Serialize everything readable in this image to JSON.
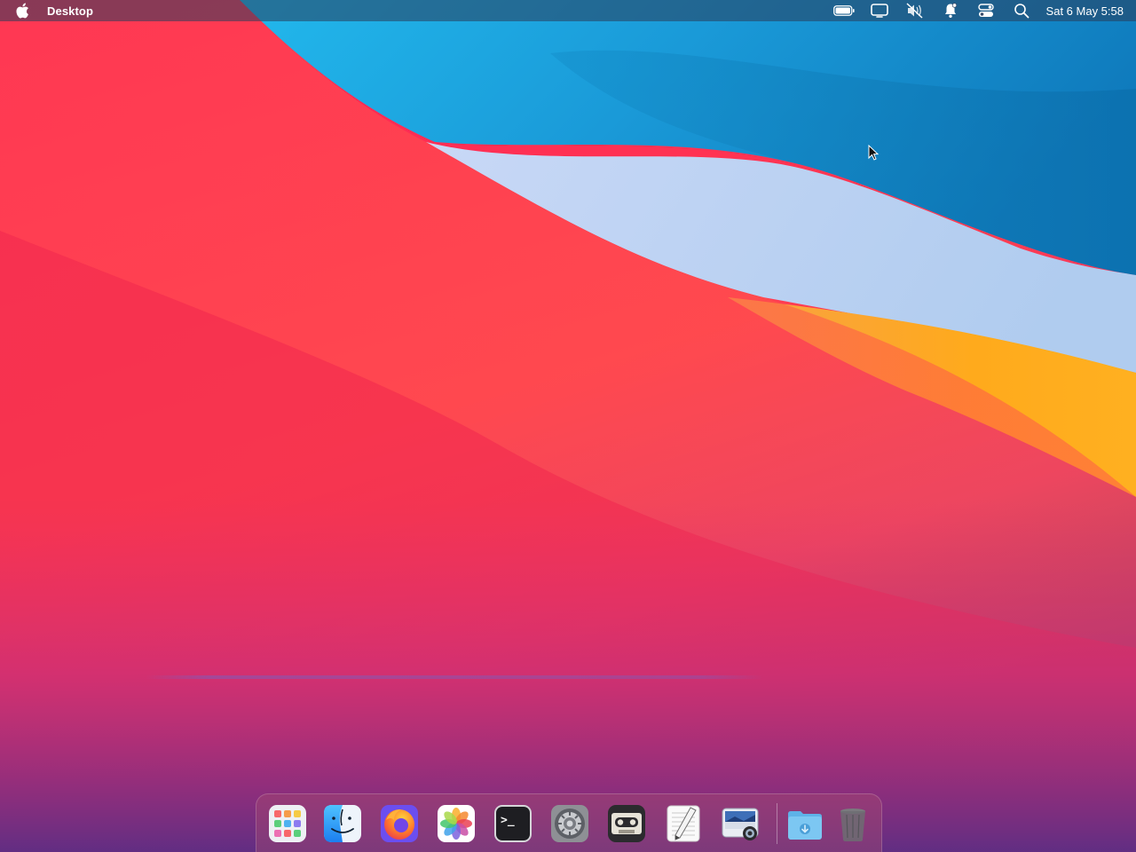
{
  "menubar": {
    "app_name": "Desktop",
    "clock": "Sat 6 May 5:58",
    "tray_icons": [
      "battery-icon",
      "display-icon",
      "volume-muted-icon",
      "notifications-icon",
      "control-center-icon",
      "search-icon"
    ]
  },
  "dock": {
    "items": [
      {
        "name": "launchpad",
        "icon": "launchpad-icon"
      },
      {
        "name": "finder",
        "icon": "finder-icon"
      },
      {
        "name": "firefox",
        "icon": "firefox-icon"
      },
      {
        "name": "photos",
        "icon": "photos-icon"
      },
      {
        "name": "terminal",
        "icon": "terminal-icon"
      },
      {
        "name": "system-preferences",
        "icon": "gear-icon"
      },
      {
        "name": "cassette-player",
        "icon": "cassette-icon"
      },
      {
        "name": "text-editor",
        "icon": "text-editor-icon"
      },
      {
        "name": "screenshot",
        "icon": "screenshot-icon"
      },
      {
        "name": "downloads",
        "icon": "downloads-folder-icon"
      },
      {
        "name": "trash",
        "icon": "trash-icon"
      }
    ],
    "terminal_prompt": ">_"
  },
  "colors": {
    "red": "#ff3b4e",
    "blue": "#1e8fd6",
    "light_blue": "#b9d4f2",
    "orange": "#ffaa22",
    "magenta": "#d8307a",
    "purple": "#5a2a7a"
  }
}
